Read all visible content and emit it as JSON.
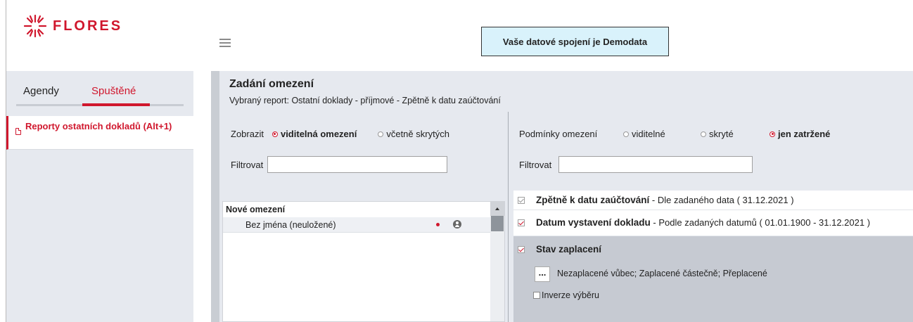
{
  "header": {
    "logo_text": "FLORES",
    "connection_text": "Vaše datové spojení je Demodata"
  },
  "sidebar": {
    "tabs": [
      {
        "label": "Agendy"
      },
      {
        "label": "Spuštěné"
      }
    ],
    "active_tab": "Spuštěné",
    "items": [
      {
        "label": "Reporty ostatních dokladů (Alt+1)"
      }
    ]
  },
  "main": {
    "title": "Zadání omezení",
    "subtitle": "Vybraný report: Ostatní doklady - příjmové - Zpětně k datu zaúčtování",
    "left": {
      "show_label": "Zobrazit",
      "show_options": [
        {
          "label": "viditelná omezení",
          "selected": true
        },
        {
          "label": "včetně skrytých",
          "selected": false
        }
      ],
      "filter_label": "Filtrovat",
      "filter_value": "",
      "list_header": "Nové omezení",
      "list_items": [
        {
          "name": "Bez jména (neuložené)"
        }
      ]
    },
    "right": {
      "conditions_label": "Podmínky omezení",
      "condition_options": [
        {
          "label": "viditelné",
          "selected": false
        },
        {
          "label": "skryté",
          "selected": false
        },
        {
          "label": "jen zatržené",
          "selected": true
        }
      ],
      "filter_label": "Filtrovat",
      "filter_value": "",
      "conditions": [
        {
          "title": "Zpětně k datu zaúčtování",
          "desc": " - Dle zadaného data ( 31.12.2021 )",
          "checked": true,
          "disabled": true
        },
        {
          "title": "Datum vystavení dokladu",
          "desc": " - Podle zadaných datumů ( 01.01.1900 - 31.12.2021 )",
          "checked": true
        },
        {
          "title": "Stav zaplacení",
          "desc": "",
          "checked": true,
          "button_label": "...",
          "selection": "Nezaplacené vůbec; Zaplacené částečně; Přeplacené",
          "invert_label": "Inverze výběru",
          "invert_checked": false
        }
      ]
    }
  },
  "colors": {
    "brand_red": "#d0172d",
    "panel_bg": "#e6e9ef",
    "connection_bg": "#d9f2fb"
  }
}
